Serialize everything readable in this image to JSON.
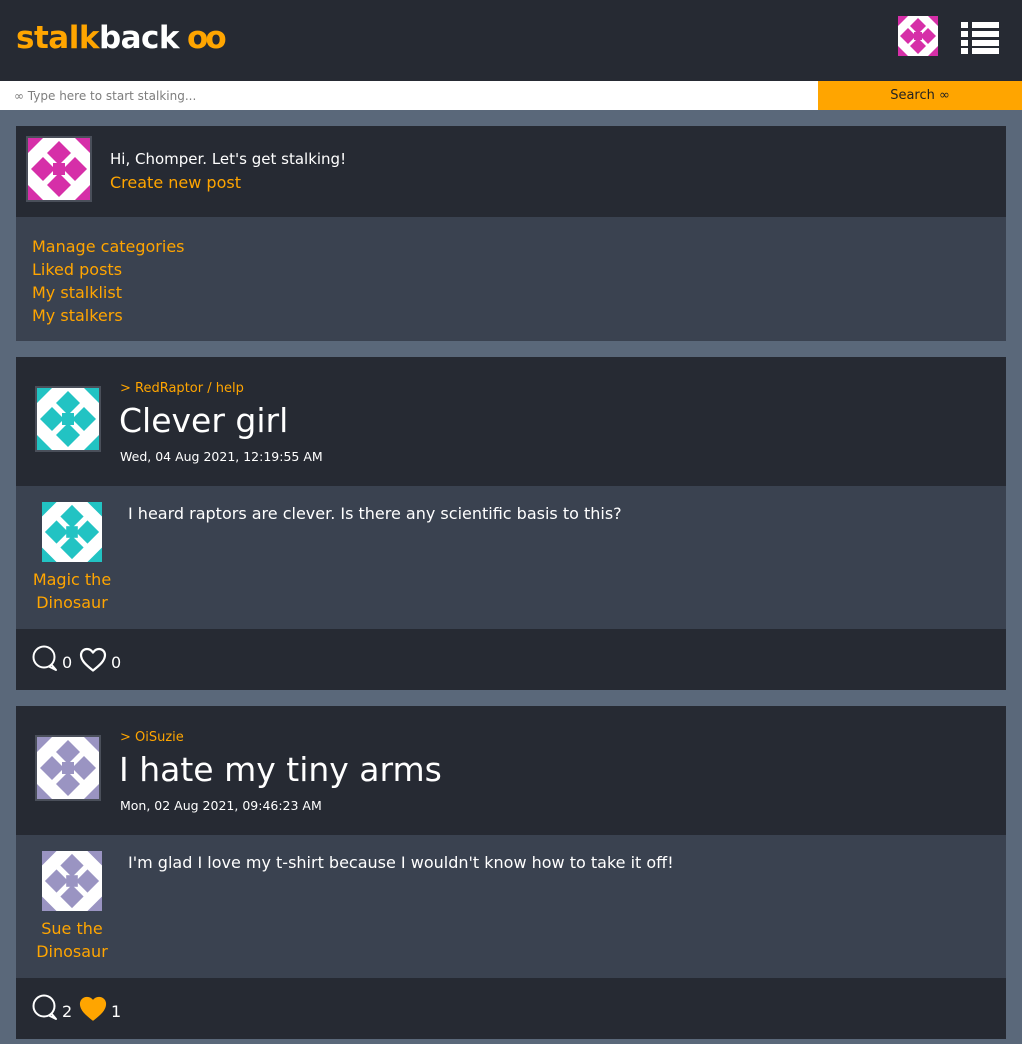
{
  "app": {
    "logo_part1": "stalk",
    "logo_part2": "back",
    "logo_part3": "oo"
  },
  "search": {
    "placeholder": "∞ Type here to start stalking...",
    "button_label": "Search ∞"
  },
  "welcome": {
    "greeting": "Hi, Chomper. Let's get stalking!",
    "create_post": "Create new post",
    "links": [
      "Manage categories",
      "Liked posts",
      "My stalklist",
      "My stalkers"
    ]
  },
  "posts": [
    {
      "breadcrumb": "> RedRaptor / help",
      "title": "Clever girl",
      "date": "Wed, 04 Aug 2021, 12:19:55 AM",
      "author_line1": "Magic the",
      "author_line2": "Dinosaur",
      "body": "I heard raptors are clever. Is there any scientific basis to this?",
      "comments": "0",
      "likes": "0",
      "liked": false,
      "avatar_color": "#22c3c3"
    },
    {
      "breadcrumb": "> OiSuzie",
      "title": "I hate my tiny arms",
      "date": "Mon, 02 Aug 2021, 09:46:23 AM",
      "author_line1": "Sue the",
      "author_line2": "Dinosaur",
      "body": "I'm glad I love my t-shirt because I wouldn't know how to take it off!",
      "comments": "2",
      "likes": "1",
      "liked": true,
      "avatar_color": "#9a94c2"
    }
  ],
  "colors": {
    "accent": "#ffa500",
    "user_avatar": "#d62fa8"
  }
}
